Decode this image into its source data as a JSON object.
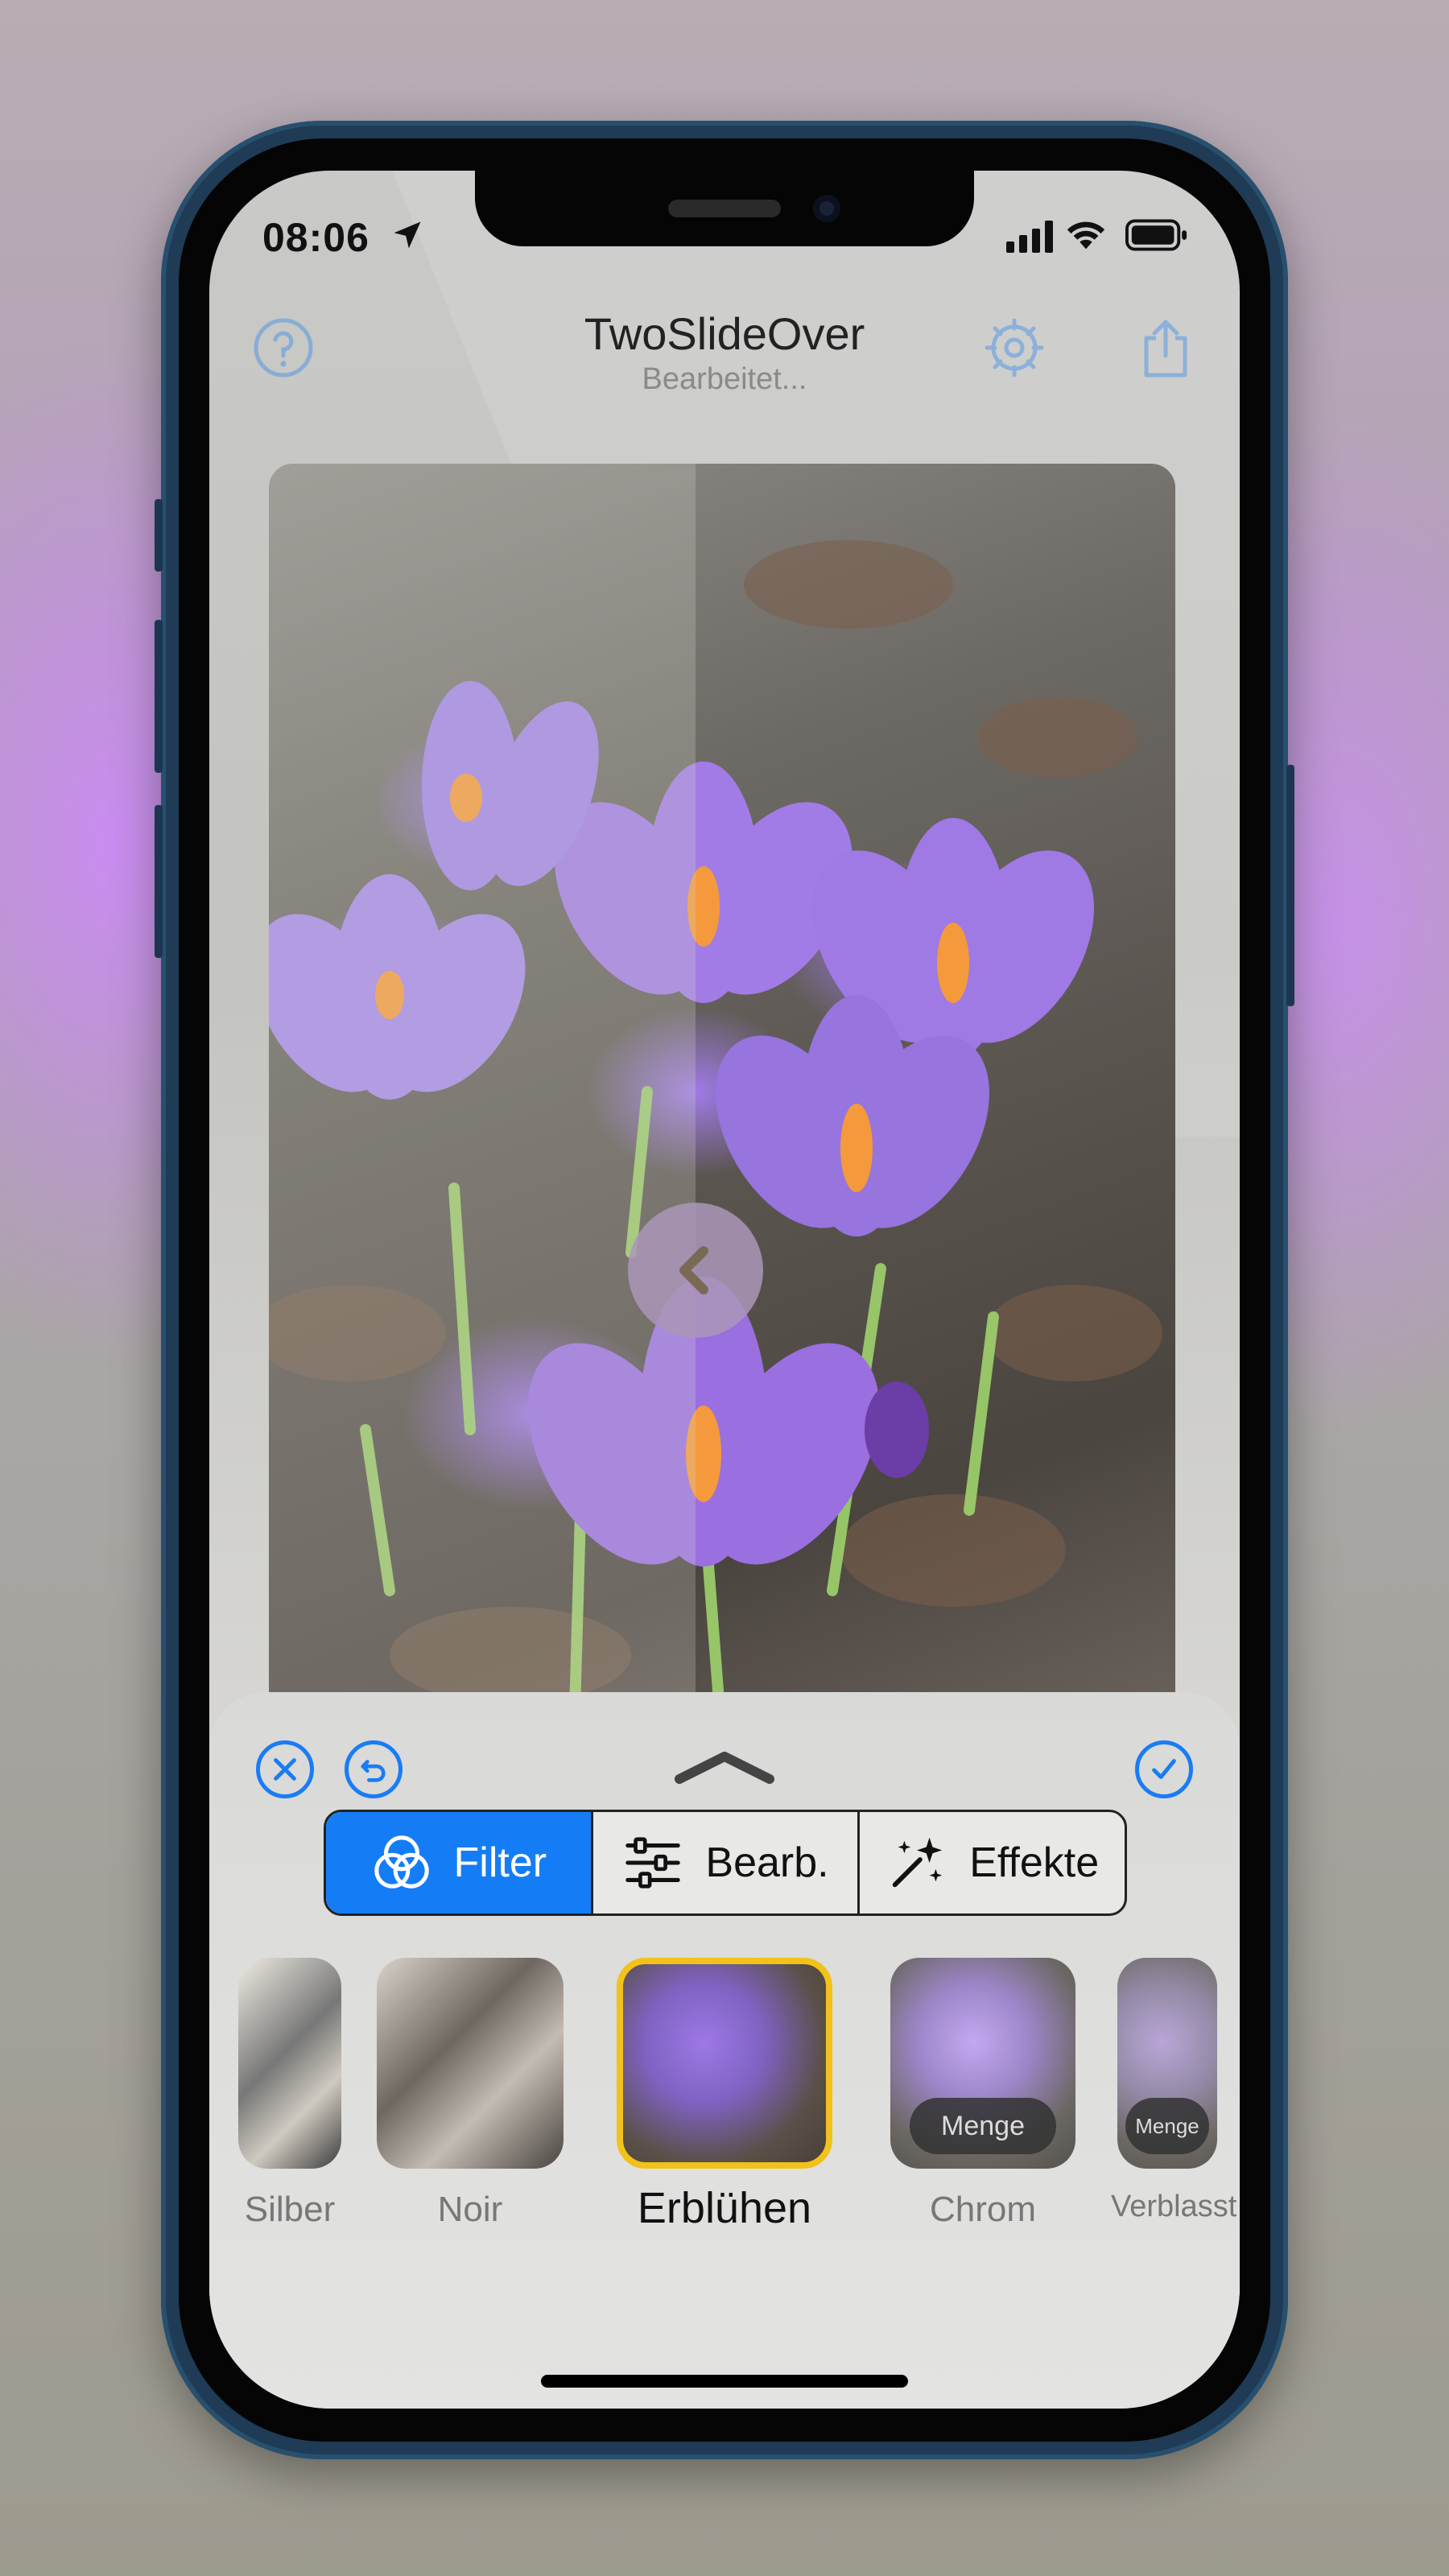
{
  "status_bar": {
    "time": "08:06"
  },
  "nav": {
    "title": "TwoSlideOver",
    "subtitle": "Bearbeitet..."
  },
  "segments": [
    {
      "label": "Filter",
      "icon": "filter-circles-icon",
      "selected": true
    },
    {
      "label": "Bearb.",
      "icon": "sliders-icon",
      "selected": false
    },
    {
      "label": "Effekte",
      "icon": "magic-wand-icon",
      "selected": false
    }
  ],
  "filters": [
    {
      "label": "Silber",
      "selected": false
    },
    {
      "label": "Noir",
      "selected": false
    },
    {
      "label": "Erblühen",
      "selected": true
    },
    {
      "label": "Chrom",
      "selected": false,
      "amount_label": "Menge"
    },
    {
      "label": "Verblasst",
      "selected": false,
      "amount_label": "Menge"
    }
  ],
  "colors": {
    "accent": "#147df5",
    "selected_border": "#f1c21a"
  }
}
